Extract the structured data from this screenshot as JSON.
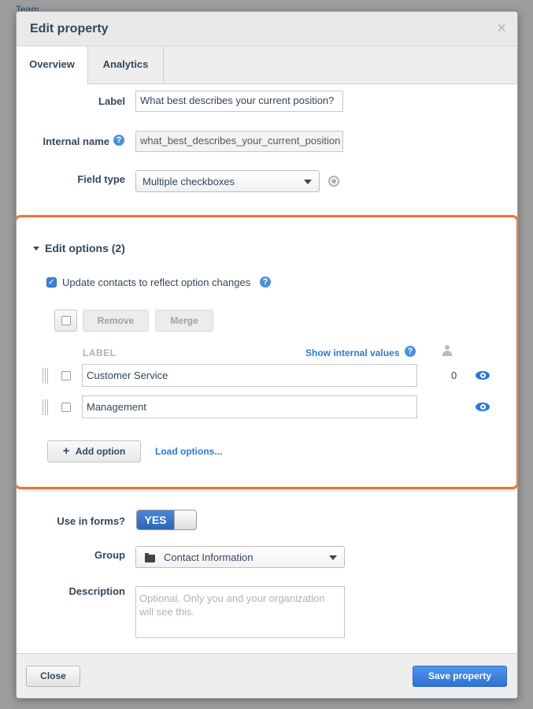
{
  "background": {
    "link_text": "Team"
  },
  "modal": {
    "title": "Edit property",
    "close_glyph": "×",
    "tabs": [
      {
        "label": "Overview",
        "active": true
      },
      {
        "label": "Analytics",
        "active": false
      }
    ]
  },
  "form": {
    "label_field": {
      "label": "Label",
      "value": "What best describes your current position?"
    },
    "internal_name": {
      "label": "Internal name",
      "value": "what_best_describes_your_current_position",
      "help_glyph": "?"
    },
    "field_type": {
      "label": "Field type",
      "value": "Multiple checkboxes"
    },
    "use_in_forms": {
      "label": "Use in forms?",
      "toggle_text": "YES",
      "on": true
    },
    "group": {
      "label": "Group",
      "value": "Contact Information"
    },
    "description": {
      "label": "Description",
      "placeholder": "Optional. Only you and your organization will see this."
    }
  },
  "edit_options": {
    "title": "Edit options (2)",
    "update_contacts_label": "Update contacts to reflect option changes",
    "update_contacts_checked": true,
    "check_glyph": "✓",
    "remove_label": "Remove",
    "merge_label": "Merge",
    "column_label": "LABEL",
    "show_internal_values": "Show internal values",
    "options": [
      {
        "label": "Customer Service",
        "count": "0"
      },
      {
        "label": "Management",
        "count": ""
      }
    ],
    "add_option_label": "Add option",
    "add_glyph": "+",
    "load_options_label": "Load options..."
  },
  "footer": {
    "close_label": "Close",
    "save_label": "Save property"
  },
  "colors": {
    "accent_blue": "#2a7ad3",
    "highlight_orange": "#e8772e",
    "primary_button": "#2f71d1"
  }
}
